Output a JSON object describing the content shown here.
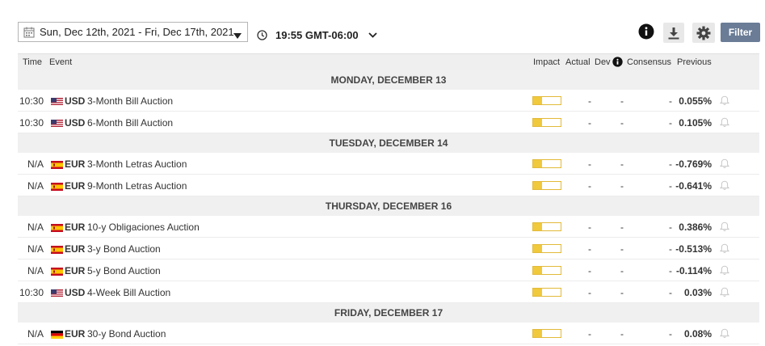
{
  "toolbar": {
    "date_range": "Sun, Dec 12th, 2021 -  Fri, Dec 17th, 2021",
    "time": "19:55 GMT-06:00",
    "filter_label": "Filter"
  },
  "columns": {
    "time": "Time",
    "event": "Event",
    "impact": "Impact",
    "actual": "Actual",
    "dev": "Dev",
    "consensus": "Consensus",
    "previous": "Previous"
  },
  "colors": {
    "impact_fill": "#f0c93c",
    "filter_button": "#6a7c96"
  },
  "days": [
    {
      "label": "MONDAY, DECEMBER 13",
      "events": [
        {
          "time": "10:30",
          "flag": "us-flag-icon",
          "currency": "USD",
          "event": "3-Month Bill Auction",
          "impact": 0.33,
          "actual": "-",
          "dev": "-",
          "consensus": "-",
          "previous": "0.055%"
        },
        {
          "time": "10:30",
          "flag": "us-flag-icon",
          "currency": "USD",
          "event": "6-Month Bill Auction",
          "impact": 0.33,
          "actual": "-",
          "dev": "-",
          "consensus": "-",
          "previous": "0.105%"
        }
      ]
    },
    {
      "label": "TUESDAY, DECEMBER 14",
      "events": [
        {
          "time": "N/A",
          "flag": "es-flag-icon",
          "currency": "EUR",
          "event": "3-Month Letras Auction",
          "impact": 0.33,
          "actual": "-",
          "dev": "-",
          "consensus": "-",
          "previous": "-0.769%"
        },
        {
          "time": "N/A",
          "flag": "es-flag-icon",
          "currency": "EUR",
          "event": "9-Month Letras Auction",
          "impact": 0.33,
          "actual": "-",
          "dev": "-",
          "consensus": "-",
          "previous": "-0.641%"
        }
      ]
    },
    {
      "label": "THURSDAY, DECEMBER 16",
      "events": [
        {
          "time": "N/A",
          "flag": "es-flag-icon",
          "currency": "EUR",
          "event": "10-y Obligaciones Auction",
          "impact": 0.33,
          "actual": "-",
          "dev": "-",
          "consensus": "-",
          "previous": "0.386%"
        },
        {
          "time": "N/A",
          "flag": "es-flag-icon",
          "currency": "EUR",
          "event": "3-y Bond Auction",
          "impact": 0.33,
          "actual": "-",
          "dev": "-",
          "consensus": "-",
          "previous": "-0.513%"
        },
        {
          "time": "N/A",
          "flag": "es-flag-icon",
          "currency": "EUR",
          "event": "5-y Bond Auction",
          "impact": 0.33,
          "actual": "-",
          "dev": "-",
          "consensus": "-",
          "previous": "-0.114%"
        },
        {
          "time": "10:30",
          "flag": "us-flag-icon",
          "currency": "USD",
          "event": "4-Week Bill Auction",
          "impact": 0.33,
          "actual": "-",
          "dev": "-",
          "consensus": "-",
          "previous": "0.03%"
        }
      ]
    },
    {
      "label": "FRIDAY, DECEMBER 17",
      "events": [
        {
          "time": "N/A",
          "flag": "de-flag-icon",
          "currency": "EUR",
          "event": "30-y Bond Auction",
          "impact": 0.33,
          "actual": "-",
          "dev": "-",
          "consensus": "-",
          "previous": "0.08%"
        }
      ]
    }
  ]
}
